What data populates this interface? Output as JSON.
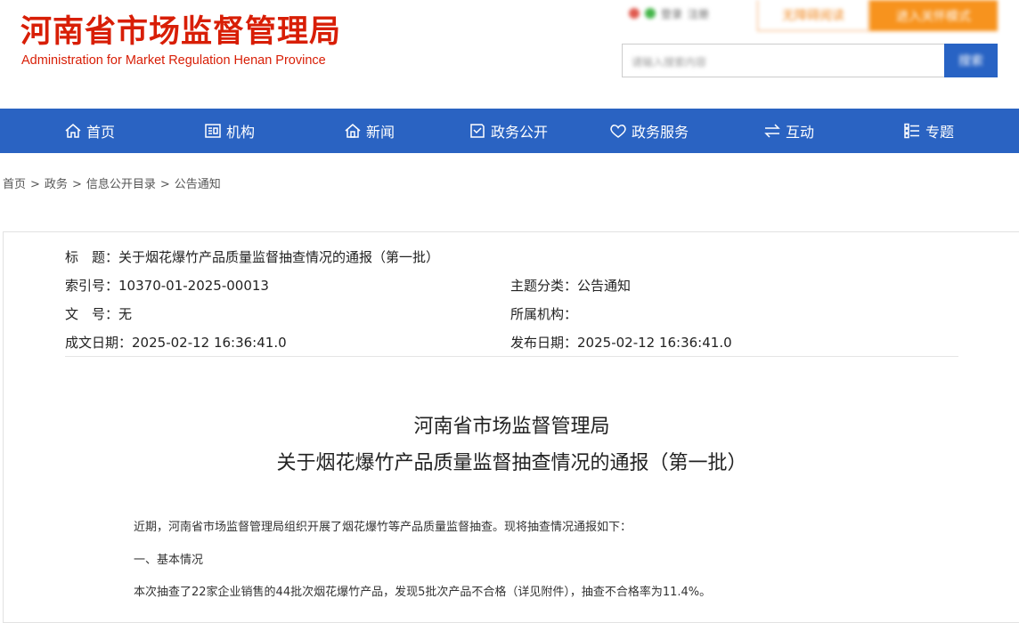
{
  "header": {
    "title_cn": "河南省市场监督管理局",
    "title_en": "Administration for Market Regulation Henan Province",
    "care_mode_label": "无障碍阅读",
    "elder_mode_label": "进入关怀模式",
    "top_tools": [
      "登录",
      "注册"
    ],
    "search_placeholder": "请输入搜索内容",
    "search_button": "搜索"
  },
  "nav": {
    "items": [
      {
        "label": "首页",
        "icon": "home-icon"
      },
      {
        "label": "机构",
        "icon": "org-icon"
      },
      {
        "label": "新闻",
        "icon": "news-icon"
      },
      {
        "label": "政务公开",
        "icon": "open-gov-icon"
      },
      {
        "label": "政务服务",
        "icon": "heart-icon"
      },
      {
        "label": "互动",
        "icon": "interact-icon"
      },
      {
        "label": "专题",
        "icon": "topic-icon"
      }
    ]
  },
  "breadcrumb": [
    "首页",
    "政务",
    "信息公开目录",
    "公告通知"
  ],
  "breadcrumb_sep": ">",
  "meta": {
    "title_label": "标　题：",
    "title_value": "关于烟花爆竹产品质量监督抽查情况的通报（第一批）",
    "index_label": "索引号：",
    "index_value": "10370-01-2025-00013",
    "category_label": "主题分类：",
    "category_value": "公告通知",
    "docno_label": "文　号：",
    "docno_value": "无",
    "org_label": "所属机构：",
    "org_value": "",
    "written_label": "成文日期：",
    "written_value": "2025-02-12 16:36:41.0",
    "published_label": "发布日期：",
    "published_value": "2025-02-12 16:36:41.0"
  },
  "article": {
    "title_line1": "河南省市场监督管理局",
    "title_line2": "关于烟花爆竹产品质量监督抽查情况的通报（第一批）",
    "paragraphs": [
      "近期，河南省市场监督管理局组织开展了烟花爆竹等产品质量监督抽查。现将抽查情况通报如下：",
      "一、基本情况",
      "本次抽查了22家企业销售的44批次烟花爆竹产品，发现5批次产品不合格（详见附件），抽查不合格率为11.4%。"
    ]
  },
  "colors": {
    "brand_red": "#d81e06",
    "nav_blue": "#2a63c2",
    "orange": "#f7931e"
  }
}
